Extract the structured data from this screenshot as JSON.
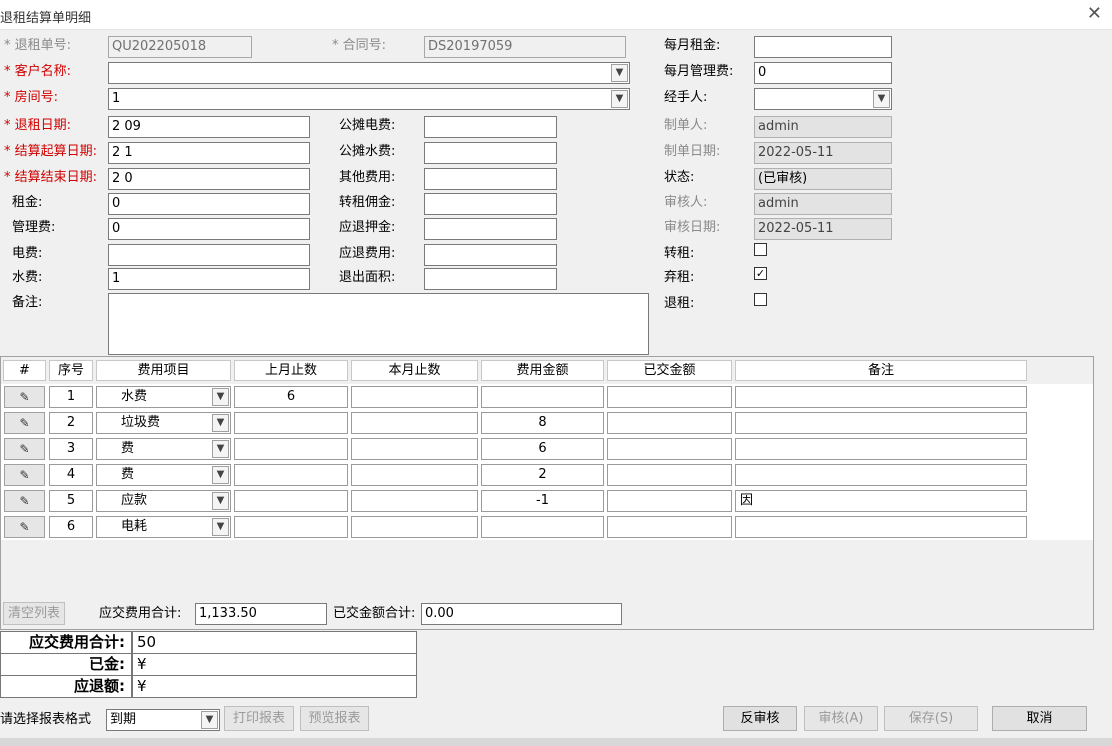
{
  "window": {
    "title": "退租结算单明细",
    "close_glyph": "✕"
  },
  "form": {
    "lease_no_label": "* 退租单号:",
    "lease_no": "QU202205018",
    "contract_no_label": "* 合同号:",
    "contract_no": "DS20197059",
    "monthly_rent_label": "每月租金:",
    "monthly_rent": "",
    "customer_label": "* 客户名称:",
    "customer": "",
    "monthly_mgmt_label": "每月管理费:",
    "monthly_mgmt": "0",
    "room_label": "* 房间号:",
    "room": "1",
    "handler_label": "经手人:",
    "handler": "",
    "lease_end_label": "* 退租日期:",
    "lease_end": "2          09",
    "shared_power_label": "公摊电费:",
    "shared_power": "",
    "creator_label": "制单人:",
    "creator": "admin",
    "settle_start_label": "* 结算起算日期:",
    "settle_start": "2          1",
    "shared_water_label": "公摊水费:",
    "shared_water": "",
    "create_date_label": "制单日期:",
    "create_date": "2022-05-11",
    "settle_end_label": "* 结算结束日期:",
    "settle_end": "2          0",
    "other_fee_label": "其他费用:",
    "other_fee": "",
    "status_label": "状态:",
    "status": "(已审核)",
    "rent_label": "租金:",
    "rent": "0",
    "sublet_comm_label": "转租佣金:",
    "sublet_comm": "",
    "auditor_label": "审核人:",
    "auditor": "admin",
    "mgmt_label": "管理费:",
    "mgmt": "0",
    "deposit_refund_label": "应退押金:",
    "deposit_refund": "",
    "audit_date_label": "审核日期:",
    "audit_date": "2022-05-11",
    "power_label": "电费:",
    "power": "",
    "fee_refund_label": "应退费用:",
    "fee_refund": "",
    "sublet_label": "转租:",
    "sublet_checked": false,
    "water_label": "水费:",
    "water": "1",
    "area_label": "退出面积:",
    "area": "",
    "abandon_label": "弃租:",
    "abandon_checked": true,
    "remark_label": "备注:",
    "remark": "",
    "refund_label": "退租:",
    "refund_checked": false
  },
  "grid": {
    "headers": [
      "#",
      "序号",
      "费用项目",
      "上月止数",
      "本月止数",
      "费用金额",
      "已交金额",
      "备注"
    ],
    "rows": [
      {
        "no": "1",
        "item": "水费",
        "prev": "6",
        "curr": "",
        "amount": "",
        "paid": "",
        "remark": ""
      },
      {
        "no": "2",
        "item": "垃圾费",
        "prev": "",
        "curr": "",
        "amount": "8",
        "paid": "",
        "remark": ""
      },
      {
        "no": "3",
        "item": "费",
        "prev": "",
        "curr": "",
        "amount": "6",
        "paid": "",
        "remark": ""
      },
      {
        "no": "4",
        "item": "费",
        "prev": "",
        "curr": "",
        "amount": "2",
        "paid": "",
        "remark": ""
      },
      {
        "no": "5",
        "item": "应款",
        "prev": "",
        "curr": "",
        "amount": "-1",
        "paid": "",
        "remark": "因"
      },
      {
        "no": "6",
        "item": "电耗",
        "prev": "",
        "curr": "",
        "amount": "",
        "paid": "",
        "remark": ""
      }
    ],
    "row_icon": "✎",
    "clear_label": "清空列表",
    "total_due_label": "应交费用合计:",
    "total_due": "1,133.50",
    "total_paid_label": "已交金额合计:",
    "total_paid": "0.00"
  },
  "summary": {
    "due_label": "应交费用合计:",
    "due_value": "50",
    "paid_label": "已金:",
    "paid_value": "¥",
    "refund_label": "应退额:",
    "refund_value": "¥"
  },
  "footer": {
    "report_format_label": "请选择报表格式",
    "report_format": "到期",
    "print_label": "打印报表",
    "preview_label": "预览报表",
    "unaudit_label": "反审核",
    "audit_label": "审核(A)",
    "save_label": "保存(S)",
    "cancel_label": "取消"
  }
}
